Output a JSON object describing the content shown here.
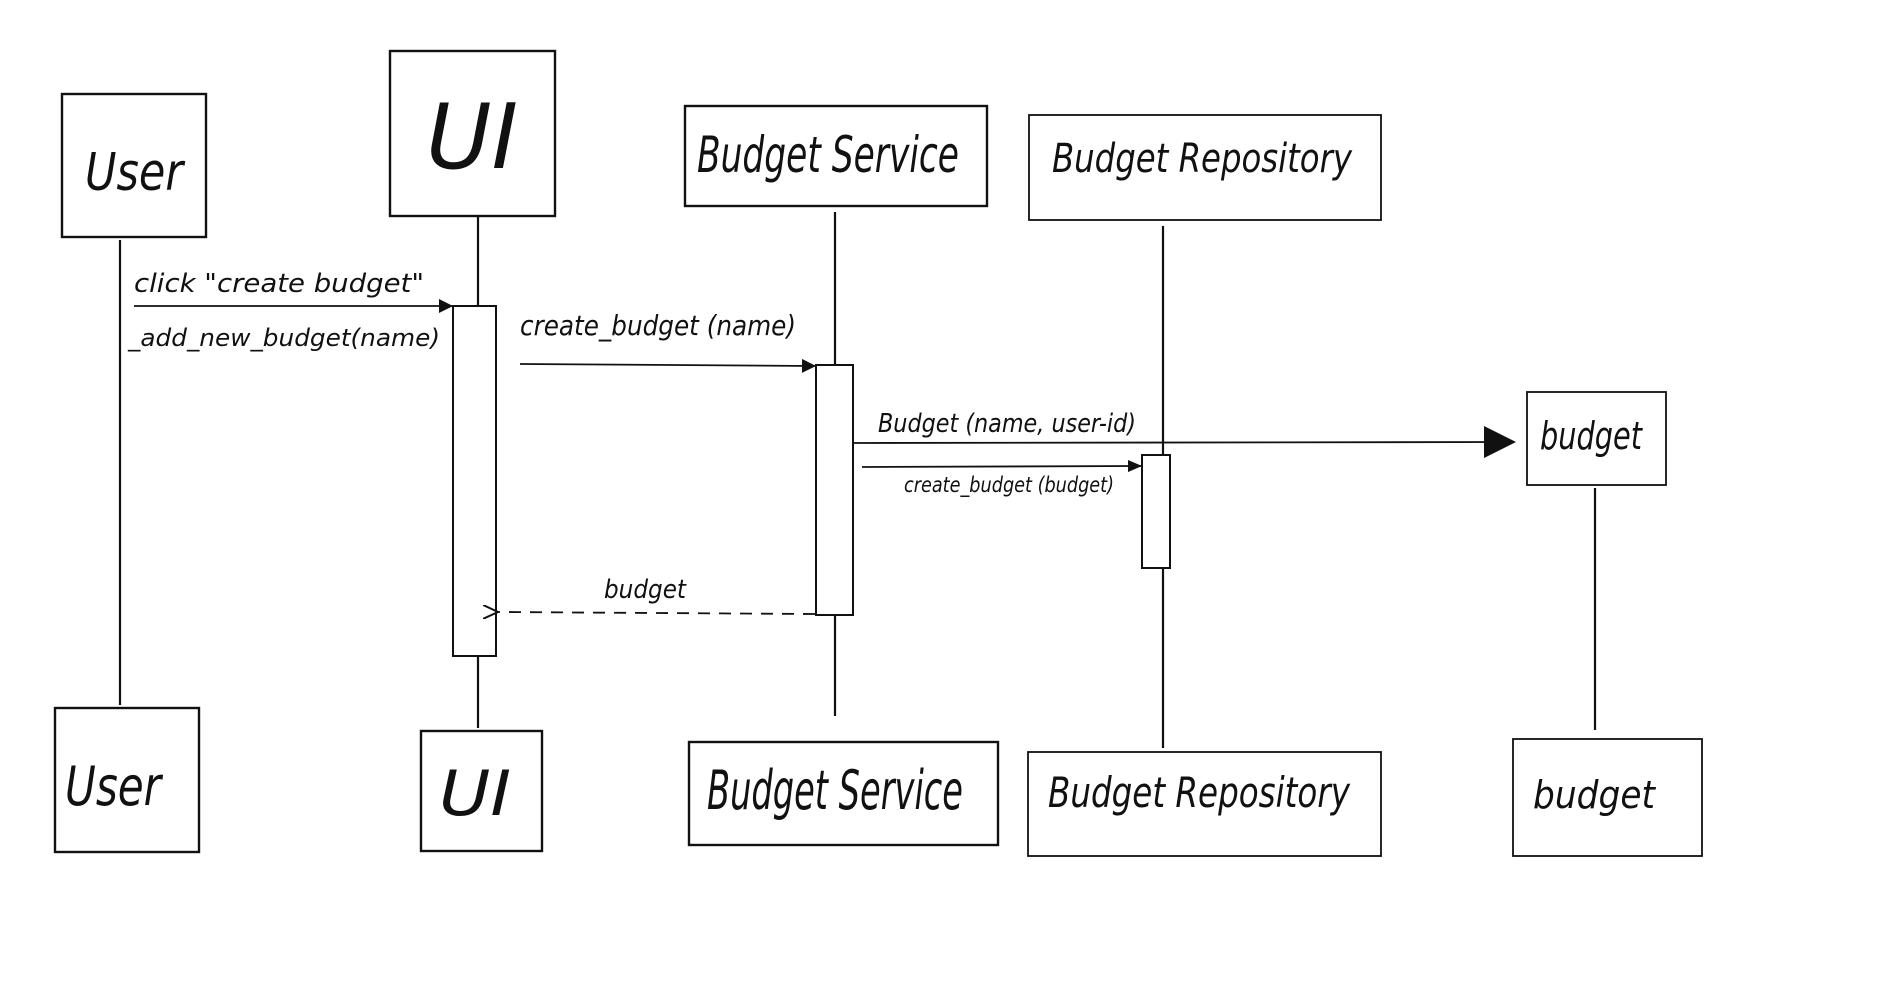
{
  "participants": {
    "user": {
      "label": "User"
    },
    "ui": {
      "label": "UI"
    },
    "service": {
      "label": "Budget Service"
    },
    "repository": {
      "label": "Budget Repository"
    },
    "budget": {
      "label": "budget"
    }
  },
  "messages": {
    "m1": {
      "label": "click \"create budget\""
    },
    "m1b": {
      "label": "_add_new_budget(name)"
    },
    "m2": {
      "label": "create_budget (name)"
    },
    "m3": {
      "label": "Budget (name, user-id)"
    },
    "m4": {
      "label": "create_budget (budget)"
    },
    "m5": {
      "label": "budget"
    }
  }
}
